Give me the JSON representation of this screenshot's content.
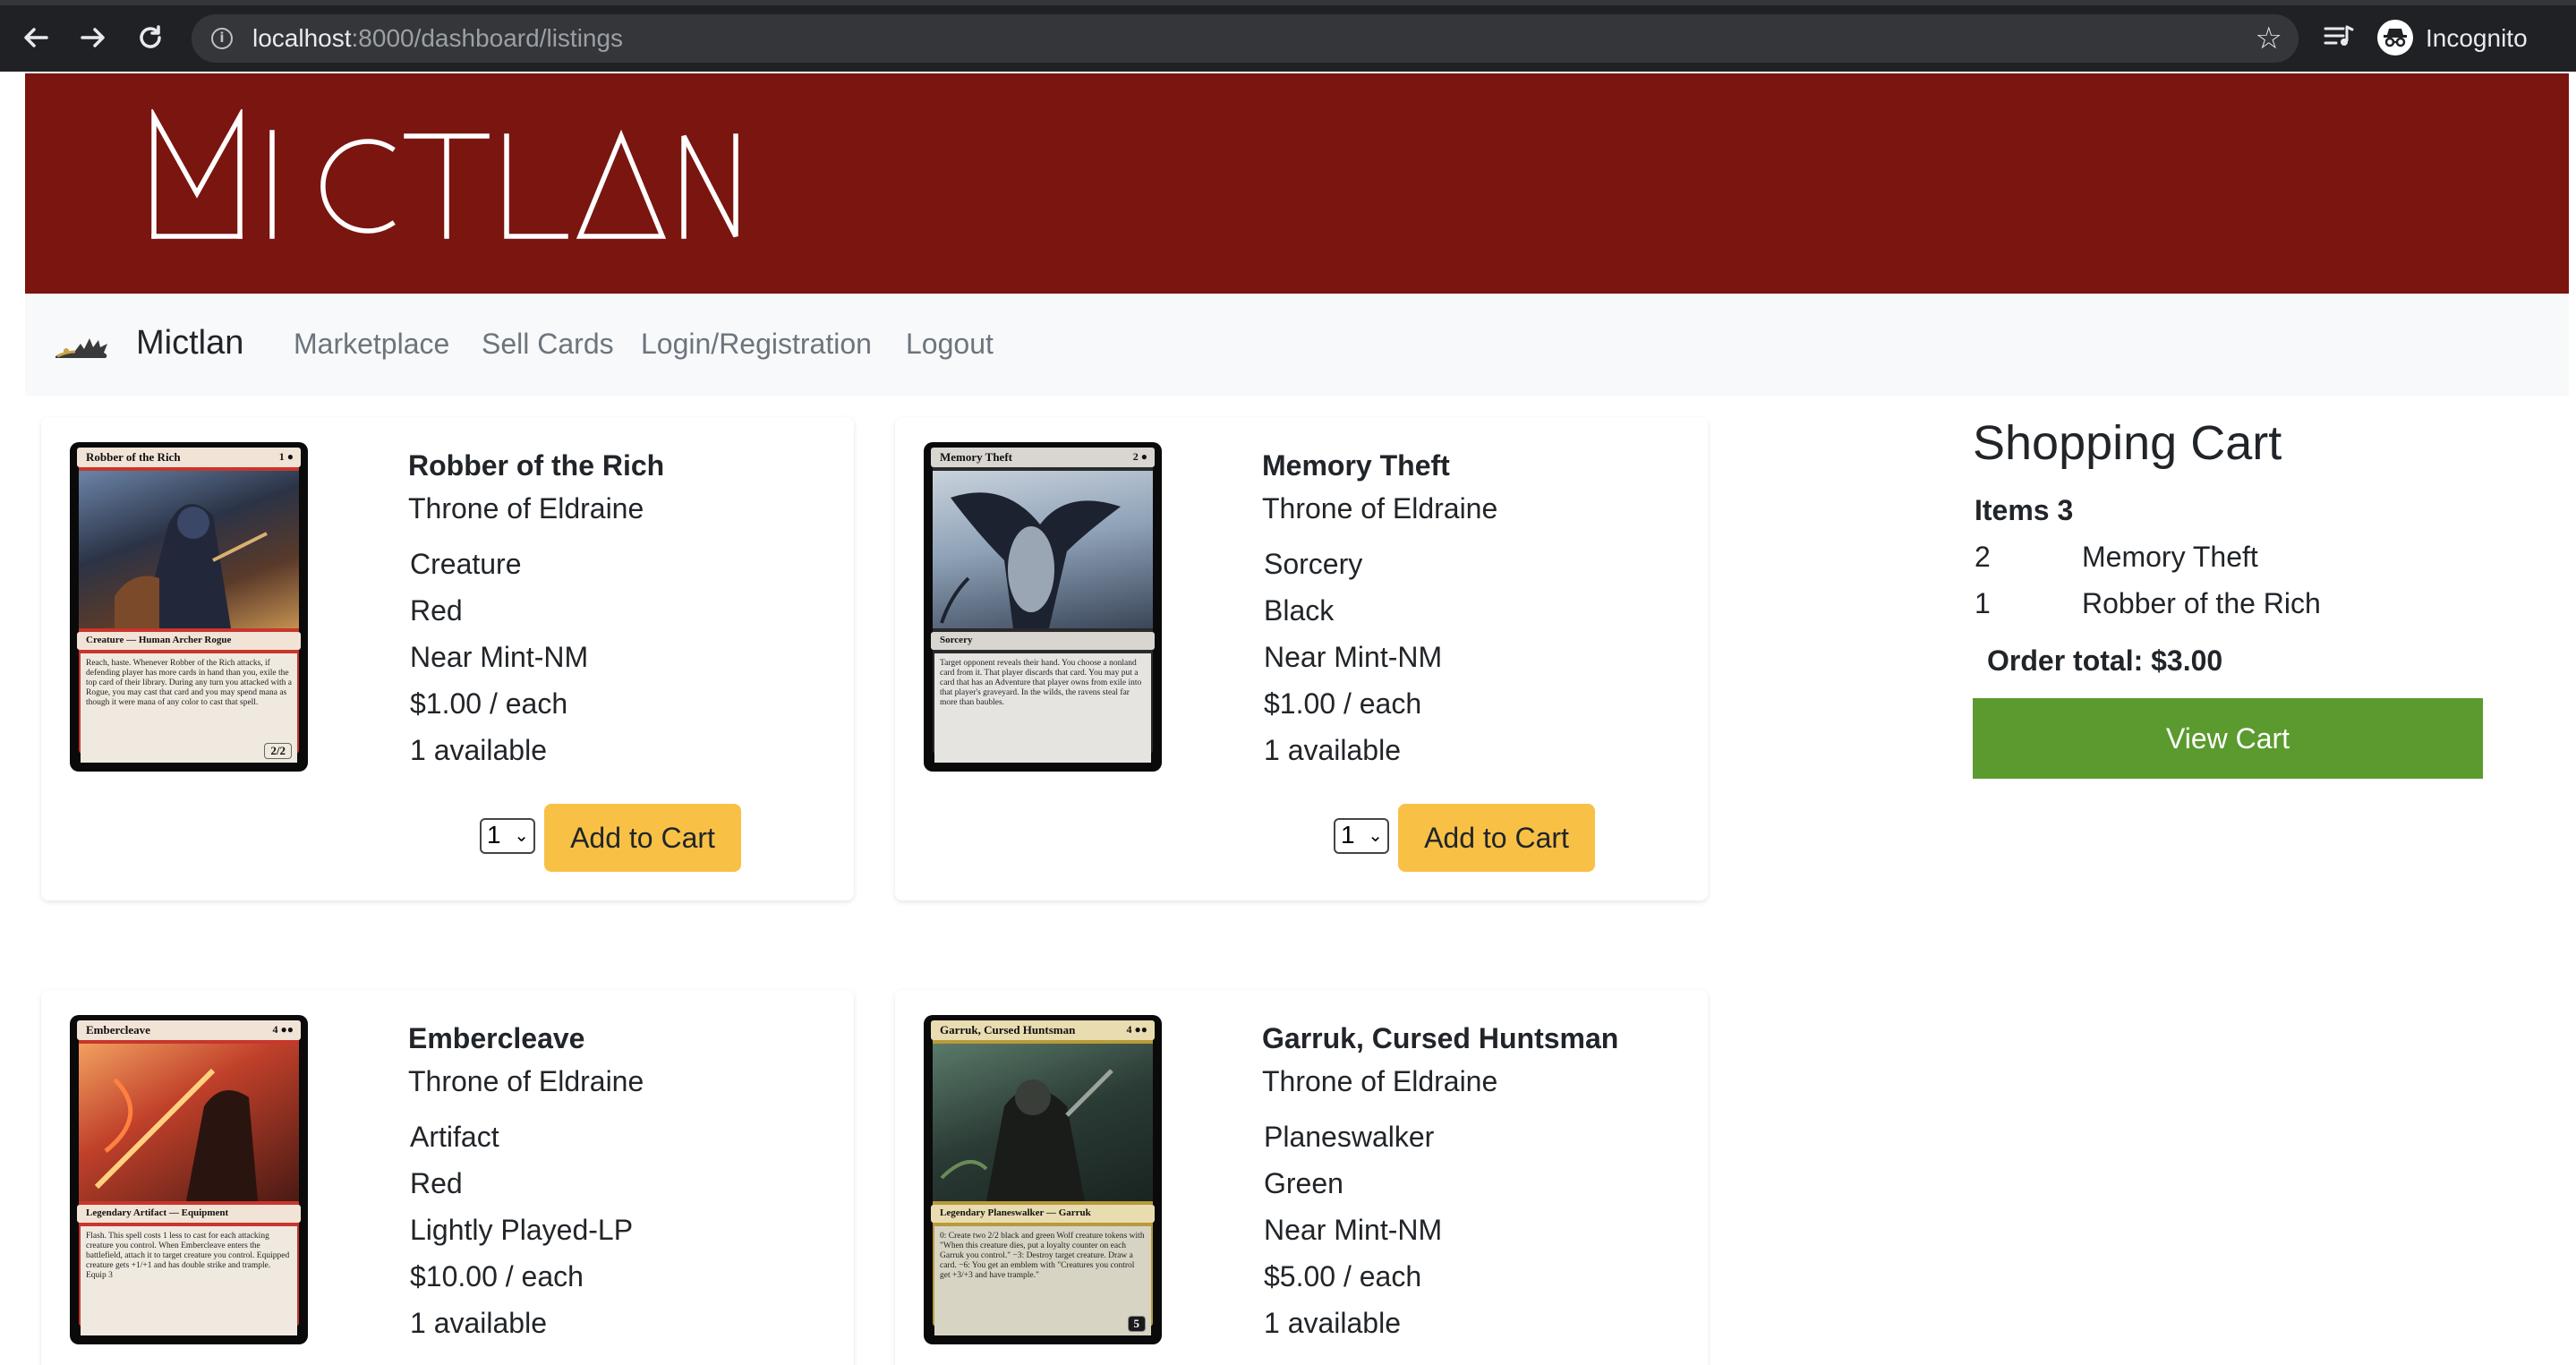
{
  "browser": {
    "url_host": "localhost",
    "url_path": ":8000/dashboard/listings",
    "profile_label": "Incognito",
    "icons": [
      "back-arrow-icon",
      "forward-arrow-icon",
      "reload-icon",
      "info-icon",
      "star-icon",
      "media-control-icon",
      "incognito-icon"
    ]
  },
  "header": {
    "logo_text": "MICTLAN",
    "banner_color": "#7a1510"
  },
  "navbar": {
    "brand": "Mictlan",
    "links": [
      "Marketplace",
      "Sell Cards",
      "Login/Registration",
      "Logout"
    ]
  },
  "listings": [
    {
      "name": "Robber of the Rich",
      "set": "Throne of Eldraine",
      "type": "Creature",
      "color": "Red",
      "condition": "Near Mint-NM",
      "price": "$1.00 / each",
      "available": "1 available",
      "qty": "1",
      "add_label": "Add to Cart",
      "card_cost": "1 ●",
      "card_type_line": "Creature — Human Archer Rogue",
      "card_text": "Reach, haste. Whenever Robber of the Rich attacks, if defending player has more cards in hand than you, exile the top card of their library. During any turn you attacked with a Rogue, you may cast that card and you may spend mana as though it were mana of any color to cast that spell.",
      "card_pt": "2/2"
    },
    {
      "name": "Memory Theft",
      "set": "Throne of Eldraine",
      "type": "Sorcery",
      "color": "Black",
      "condition": "Near Mint-NM",
      "price": "$1.00 / each",
      "available": "1 available",
      "qty": "1",
      "add_label": "Add to Cart",
      "card_cost": "2 ●",
      "card_type_line": "Sorcery",
      "card_text": "Target opponent reveals their hand. You choose a nonland card from it. That player discards that card. You may put a card that has an Adventure that player owns from exile into that player's graveyard. In the wilds, the ravens steal far more than baubles.",
      "card_pt": ""
    },
    {
      "name": "Embercleave",
      "set": "Throne of Eldraine",
      "type": "Artifact",
      "color": "Red",
      "condition": "Lightly Played-LP",
      "price": "$10.00 / each",
      "available": "1 available",
      "qty": "1",
      "add_label": "Add to Cart",
      "card_cost": "4 ●●",
      "card_type_line": "Legendary Artifact — Equipment",
      "card_text": "Flash. This spell costs 1 less to cast for each attacking creature you control. When Embercleave enters the battlefield, attach it to target creature you control. Equipped creature gets +1/+1 and has double strike and trample. Equip 3",
      "card_pt": ""
    },
    {
      "name": "Garruk, Cursed Huntsman",
      "set": "Throne of Eldraine",
      "type": "Planeswalker",
      "color": "Green",
      "condition": "Near Mint-NM",
      "price": "$5.00 / each",
      "available": "1 available",
      "qty": "1",
      "add_label": "Add to Cart",
      "card_cost": "4 ●●",
      "card_type_line": "Legendary Planeswalker — Garruk",
      "card_text": "0: Create two 2/2 black and green Wolf creature tokens with \"When this creature dies, put a loyalty counter on each Garruk you control.\" −3: Destroy target creature. Draw a card. −6: You get an emblem with \"Creatures you control get +3/+3 and have trample.\"",
      "card_pt": "5"
    }
  ],
  "cart": {
    "title": "Shopping Cart",
    "items_label": "Items 3",
    "items": [
      {
        "qty": "2",
        "name": "Memory Theft"
      },
      {
        "qty": "1",
        "name": "Robber of the Rich"
      }
    ],
    "order_total": "Order total: $3.00",
    "view_cart_label": "View Cart",
    "button_color": "#5b9a2e"
  }
}
